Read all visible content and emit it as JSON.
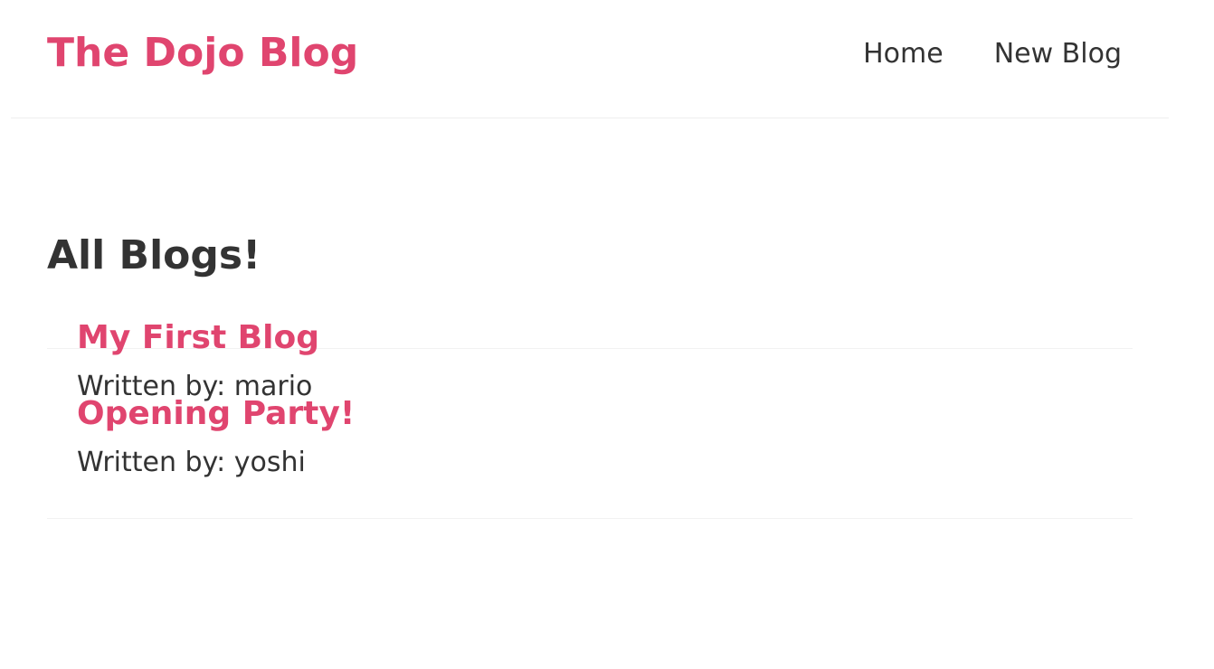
{
  "header": {
    "brand": "The Dojo Blog",
    "links": [
      {
        "label": "Home"
      },
      {
        "label": "New Blog"
      }
    ]
  },
  "main": {
    "heading": "All Blogs!",
    "author_prefix": "Written by: ",
    "blogs": [
      {
        "title": "My First Blog",
        "author": "mario"
      },
      {
        "title": "Opening Party!",
        "author": "yoshi"
      }
    ]
  },
  "colors": {
    "accent": "#e0456f",
    "text": "#333333",
    "divider": "#eeeeee"
  }
}
